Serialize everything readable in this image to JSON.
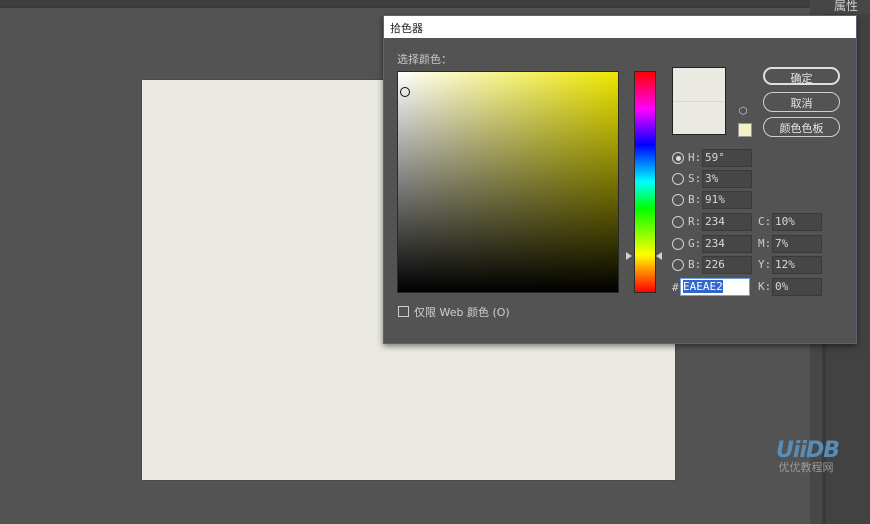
{
  "panel": {
    "properties_label": "属性"
  },
  "watermark": {
    "logo": "UiiDB",
    "text": "优优教程网"
  },
  "dialog": {
    "title": "拾色器",
    "select_label": "选择颜色：",
    "buttons": {
      "ok": "确定",
      "cancel": "取消",
      "swatches": "颜色色板"
    },
    "fields": {
      "H": {
        "label": "H:",
        "value": "59°"
      },
      "S": {
        "label": "S:",
        "value": "3%"
      },
      "Bv": {
        "label": "B:",
        "value": "91%"
      },
      "R": {
        "label": "R:",
        "value": "234"
      },
      "G": {
        "label": "G:",
        "value": "234"
      },
      "Bb": {
        "label": "B:",
        "value": "226"
      },
      "C": {
        "label": "C:",
        "value": "10%"
      },
      "M": {
        "label": "M:",
        "value": "7%"
      },
      "Y": {
        "label": "Y:",
        "value": "12%"
      },
      "K": {
        "label": "K:",
        "value": "0%"
      }
    },
    "hash_label": "#",
    "hex_value": "EAEAE2",
    "web_only_label": "仅限 Web 颜色 (O)",
    "selected_mode": "H"
  },
  "colors": {
    "current": "#EAEAE2",
    "hue_pure": "#EEE600",
    "canvas": "#EAEAE2"
  },
  "icons": {
    "gamut": "cube-warning-icon"
  }
}
